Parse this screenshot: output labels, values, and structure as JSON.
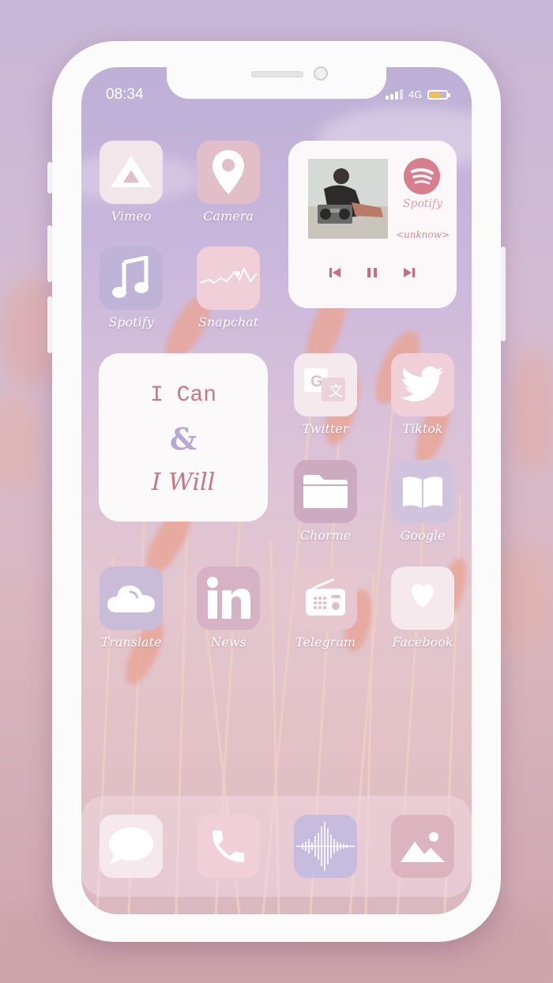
{
  "status_bar": {
    "time": "08:34",
    "network": "4G"
  },
  "apps": {
    "vimeo": "Vimeo",
    "camera": "Camera",
    "spotify": "Spotify",
    "snapchat": "Snapchat",
    "twitter": "Twitter",
    "tiktok": "Tiktok",
    "chrome": "Chorme",
    "google": "Google",
    "translate": "Translate",
    "news": "News",
    "telegram": "Telegram",
    "facebook": "Facebook"
  },
  "spotify_widget": {
    "app_name": "Spotify",
    "track": "<unknow>"
  },
  "quote_widget": {
    "line1": "I Can",
    "line2": "&",
    "line3": "I Will"
  },
  "icons": {
    "vimeo": "drive-triangle-icon",
    "camera": "location-pin-icon",
    "spotify": "music-note-icon",
    "snapchat": "pulse-line-icon",
    "twitter": "translate-icon",
    "tiktok": "twitter-bird-icon",
    "chrome": "folder-icon",
    "google": "book-icon",
    "translate": "cloud-icon",
    "news": "linkedin-icon",
    "telegram": "radio-icon",
    "facebook": "heart-icon",
    "dock": [
      "message-icon",
      "phone-icon",
      "soundwave-icon",
      "photos-icon"
    ]
  },
  "colors": {
    "accent": "#d77f8e",
    "lavender": "#b7a7d2",
    "battery": "#f7c23f"
  }
}
